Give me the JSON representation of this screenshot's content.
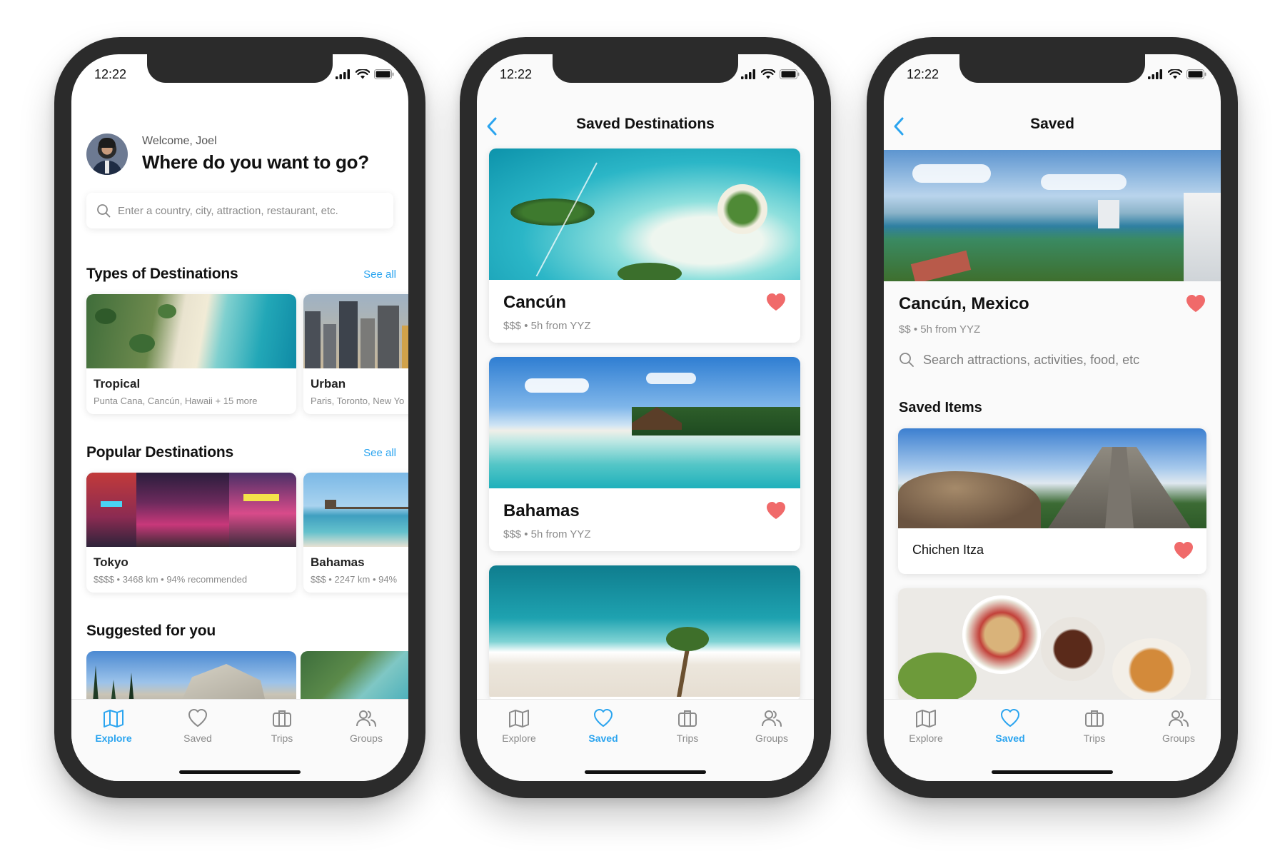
{
  "status": {
    "time": "12:22"
  },
  "colors": {
    "accent": "#2aa4ef",
    "heart": "#f06a6a"
  },
  "tabs": [
    {
      "label": "Explore",
      "icon": "map-icon"
    },
    {
      "label": "Saved",
      "icon": "heart-icon"
    },
    {
      "label": "Trips",
      "icon": "briefcase-icon"
    },
    {
      "label": "Groups",
      "icon": "users-icon"
    }
  ],
  "explore": {
    "welcome": "Welcome, Joel",
    "headline": "Where do you want to go?",
    "search_placeholder": "Enter a country, city, attraction, restaurant, etc.",
    "types_title": "Types of Destinations",
    "see_all": "See all",
    "types": [
      {
        "name": "Tropical",
        "sub": "Punta Cana, Cancún, Hawaii + 15 more"
      },
      {
        "name": "Urban",
        "sub": "Paris, Toronto, New Yo"
      }
    ],
    "popular_title": "Popular Destinations",
    "popular": [
      {
        "name": "Tokyo",
        "sub": "$$$$ • 3468 km • 94% recommended"
      },
      {
        "name": "Bahamas",
        "sub": "$$$ • 2247 km • 94%"
      }
    ],
    "suggested_title": "Suggested for you"
  },
  "saved_destinations": {
    "title": "Saved Destinations",
    "items": [
      {
        "name": "Cancún",
        "sub": "$$$ • 5h from YYZ"
      },
      {
        "name": "Bahamas",
        "sub": "$$$ • 5h from YYZ"
      }
    ]
  },
  "saved_detail": {
    "title": "Saved",
    "place": "Cancún, Mexico",
    "sub": "$$ • 5h from YYZ",
    "search_placeholder": "Search attractions, activities, food, etc",
    "items_title": "Saved Items",
    "items": [
      {
        "name": "Chichen Itza"
      }
    ]
  }
}
